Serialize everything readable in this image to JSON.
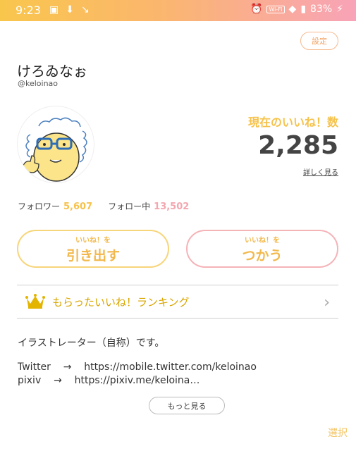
{
  "status_bar": {
    "time": "9:23",
    "battery": "83%",
    "wifi_label": "Wi-Fi"
  },
  "profile": {
    "settings_label": "設定",
    "username": "けろゐなぉ",
    "handle": "@keloinao",
    "likes_label": "現在のいいね！数",
    "likes_value": "2,285",
    "likes_detail": "詳しく見る",
    "followers_label": "フォロワー",
    "followers_value": "5,607",
    "following_label": "フォロー中",
    "following_value": "13,502"
  },
  "actions": {
    "withdraw_small": "いいね！を",
    "withdraw_big": "引き出す",
    "use_small": "いいね！を",
    "use_big": "つかう"
  },
  "ranking": {
    "label": "もらったいいね！ランキング"
  },
  "bio": {
    "text": "イラストレーター（自称）です。",
    "twitter_label": "Twitter",
    "arrow1": "→",
    "twitter_url": "https://mobile.twitter.com/keloinao",
    "pixiv_label": "pixiv",
    "arrow2": "→",
    "pixiv_url": "https://pixiv.me/keloina…",
    "more_label": "もっと見る"
  },
  "footer": {
    "select_label": "選択"
  },
  "colors": {
    "accent_yellow": "#f6c24c",
    "accent_pink": "#f4a6ae",
    "settings_orange": "#f2a163"
  }
}
